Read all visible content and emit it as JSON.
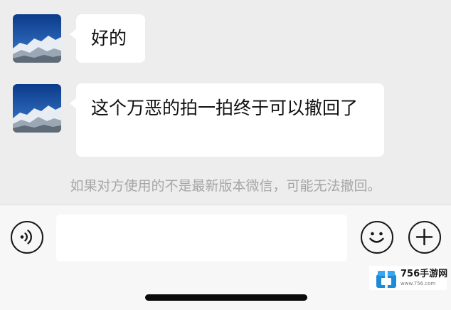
{
  "messages": [
    {
      "sender": "other",
      "text": "好的",
      "avatar": "mountain-avatar"
    },
    {
      "sender": "other",
      "text": "这个万恶的拍一拍终于可以撤回了",
      "avatar": "mountain-avatar"
    }
  ],
  "system_notice": "如果对方使用的不是最新版本微信，可能无法撤回。",
  "input_bar": {
    "voice_icon": "voice-icon",
    "input_value": "",
    "emoji_icon": "emoji-icon",
    "plus_icon": "plus-icon"
  },
  "watermark": {
    "name": "756手游网",
    "url": "www.756.com"
  },
  "colors": {
    "chat_background": "#ededed",
    "bubble": "#ffffff",
    "notice_text": "#a6a6a6",
    "input_bar": "#f7f7f7",
    "watermark_logo": "#1e8bd8"
  }
}
